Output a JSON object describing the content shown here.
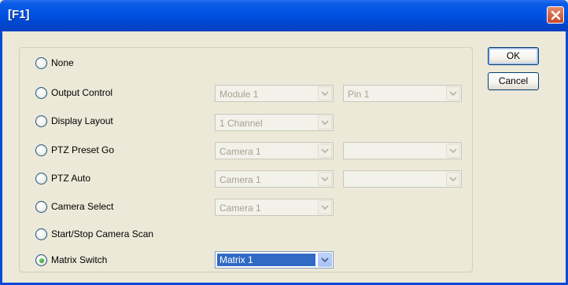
{
  "window": {
    "title": "[F1]"
  },
  "buttons": {
    "ok": "OK",
    "cancel": "Cancel"
  },
  "options": {
    "none": {
      "label": "None",
      "selected": false
    },
    "output_control": {
      "label": "Output Control",
      "selected": false,
      "combo1": "Module 1",
      "combo2": "Pin 1"
    },
    "display_layout": {
      "label": "Display Layout",
      "selected": false,
      "combo1": "1 Channel"
    },
    "ptz_preset_go": {
      "label": "PTZ Preset Go",
      "selected": false,
      "combo1": "Camera 1",
      "combo2": ""
    },
    "ptz_auto": {
      "label": "PTZ Auto",
      "selected": false,
      "combo1": "Camera 1",
      "combo2": ""
    },
    "camera_select": {
      "label": "Camera Select",
      "selected": false,
      "combo1": "Camera 1"
    },
    "start_stop_scan": {
      "label": "Start/Stop Camera Scan",
      "selected": false
    },
    "matrix_switch": {
      "label": "Matrix Switch",
      "selected": true,
      "combo1": "Matrix 1"
    }
  },
  "colors": {
    "title_bar": "#0053e3",
    "dialog_bg": "#ece9d8",
    "selection": "#316ac5"
  }
}
